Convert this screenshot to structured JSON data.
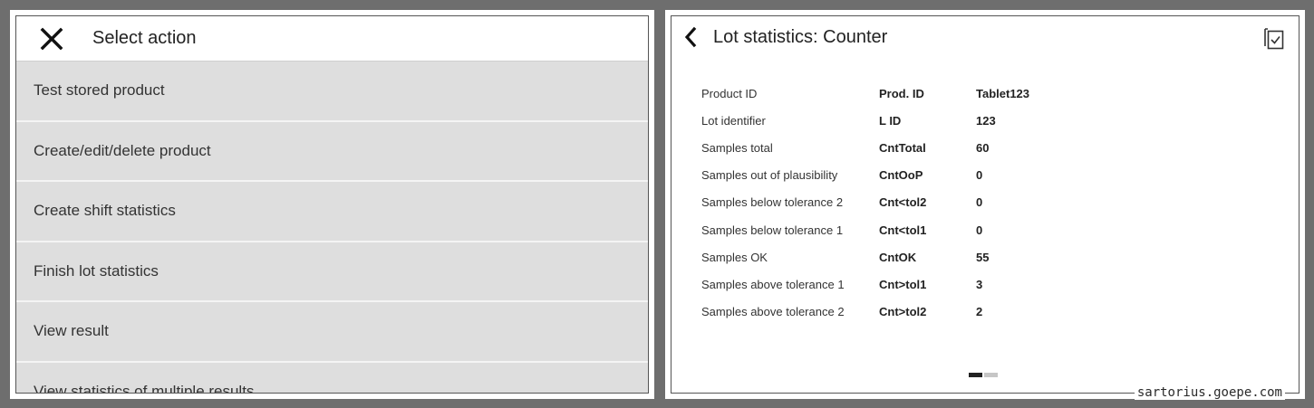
{
  "action_menu": {
    "title": "Select action",
    "close_icon": "close-icon",
    "items": [
      {
        "label": "Test stored product"
      },
      {
        "label": "Create/edit/delete product"
      },
      {
        "label": "Create shift statistics"
      },
      {
        "label": "Finish lot statistics"
      },
      {
        "label": "View result"
      },
      {
        "label": "View statistics of multiple results"
      }
    ]
  },
  "lot_stats": {
    "title": "Lot statistics: Counter",
    "back_icon": "chevron-left-icon",
    "export_icon": "document-check-icon",
    "rows": [
      {
        "label": "Product ID",
        "code": "Prod. ID",
        "value": "Tablet123"
      },
      {
        "label": "Lot identifier",
        "code": "L ID",
        "value": "123"
      },
      {
        "label": "Samples total",
        "code": "CntTotal",
        "value": "60"
      },
      {
        "label": "Samples out of plausibility",
        "code": "CntOoP",
        "value": "0"
      },
      {
        "label": "Samples below tolerance 2",
        "code": "Cnt<tol2",
        "value": "0"
      },
      {
        "label": "Samples below tolerance 1",
        "code": "Cnt<tol1",
        "value": "0"
      },
      {
        "label": "Samples OK",
        "code": "CntOK",
        "value": "55"
      },
      {
        "label": "Samples above tolerance 1",
        "code": "Cnt>tol1",
        "value": "3"
      },
      {
        "label": "Samples above tolerance 2",
        "code": "Cnt>tol2",
        "value": "2"
      }
    ],
    "pager": {
      "pages": 2,
      "current": 1
    }
  },
  "watermark": "sartorius.goepe.com"
}
